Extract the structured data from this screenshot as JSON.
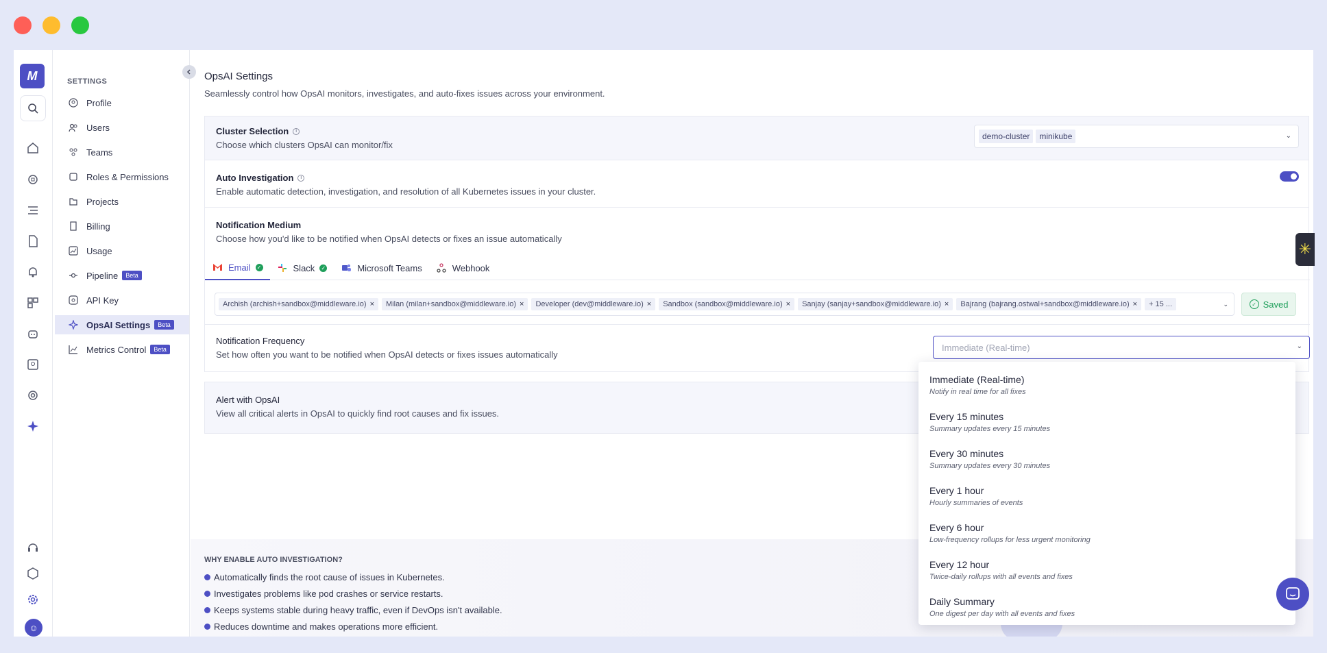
{
  "sidebar": {
    "heading": "SETTINGS",
    "items": [
      {
        "label": "Profile",
        "icon": "profile-icon"
      },
      {
        "label": "Users",
        "icon": "users-icon"
      },
      {
        "label": "Teams",
        "icon": "teams-icon"
      },
      {
        "label": "Roles & Permissions",
        "icon": "roles-icon"
      },
      {
        "label": "Projects",
        "icon": "projects-icon"
      },
      {
        "label": "Billing",
        "icon": "billing-icon"
      },
      {
        "label": "Usage",
        "icon": "usage-icon"
      },
      {
        "label": "Pipeline",
        "icon": "pipeline-icon",
        "badge": "Beta"
      },
      {
        "label": "API Key",
        "icon": "api-key-icon"
      },
      {
        "label": "OpsAI Settings",
        "icon": "opsai-icon",
        "badge": "Beta",
        "active": true
      },
      {
        "label": "Metrics Control",
        "icon": "metrics-control-icon",
        "badge": "Beta"
      }
    ]
  },
  "page": {
    "title": "OpsAI Settings",
    "subtitle": "Seamlessly control how OpsAI monitors, investigates, and auto-fixes issues across your environment."
  },
  "cluster": {
    "title": "Cluster Selection",
    "desc": "Choose which clusters OpsAI can monitor/fix",
    "chips": [
      "demo-cluster",
      "minikube"
    ]
  },
  "auto_investigation": {
    "title": "Auto Investigation",
    "desc": "Enable automatic detection, investigation, and resolution of all Kubernetes issues in your cluster.",
    "enabled": true
  },
  "notification_medium": {
    "title": "Notification Medium",
    "desc": "Choose how you'd like to be notified when OpsAI detects or fixes an issue automatically",
    "tabs": [
      {
        "label": "Email",
        "verified": true,
        "active": true
      },
      {
        "label": "Slack",
        "verified": true
      },
      {
        "label": "Microsoft Teams"
      },
      {
        "label": "Webhook"
      }
    ],
    "recipients": [
      "Archish (archish+sandbox@middleware.io)",
      "Milan (milan+sandbox@middleware.io)",
      "Developer (dev@middleware.io)",
      "Sandbox (sandbox@middleware.io)",
      "Sanjay (sanjay+sandbox@middleware.io)",
      "Bajrang (bajrang.ostwal+sandbox@middleware.io)"
    ],
    "more": "+ 15 ...",
    "saved_label": "Saved"
  },
  "notification_frequency": {
    "title": "Notification Frequency",
    "desc": "Set how often you want to be notified when OpsAI detects or fixes issues automatically",
    "placeholder": "Immediate (Real-time)",
    "options": [
      {
        "label": "Immediate (Real-time)",
        "desc": "Notify in real time for all fixes"
      },
      {
        "label": "Every 15 minutes",
        "desc": "Summary updates every 15 minutes"
      },
      {
        "label": "Every 30 minutes",
        "desc": "Summary updates every 30 minutes"
      },
      {
        "label": "Every 1 hour",
        "desc": "Hourly summaries of events"
      },
      {
        "label": "Every 6 hour",
        "desc": "Low-frequency rollups for less urgent monitoring"
      },
      {
        "label": "Every 12 hour",
        "desc": "Twice-daily rollups with all events and fixes"
      },
      {
        "label": "Daily Summary",
        "desc": "One digest per day with all events and fixes"
      }
    ]
  },
  "alert": {
    "title": "Alert with OpsAI",
    "desc": "View all critical alerts in OpsAI to quickly find root causes and fix issues."
  },
  "why": {
    "title": "WHY ENABLE AUTO INVESTIGATION?",
    "items": [
      "Automatically finds the root cause of issues in Kubernetes.",
      "Investigates problems like pod crashes or service restarts.",
      "Keeps systems stable during heavy traffic, even if DevOps isn't available.",
      "Reduces downtime and makes operations more efficient."
    ]
  },
  "colors": {
    "accent": "#4d4fc4",
    "success": "#1f9f5b"
  }
}
